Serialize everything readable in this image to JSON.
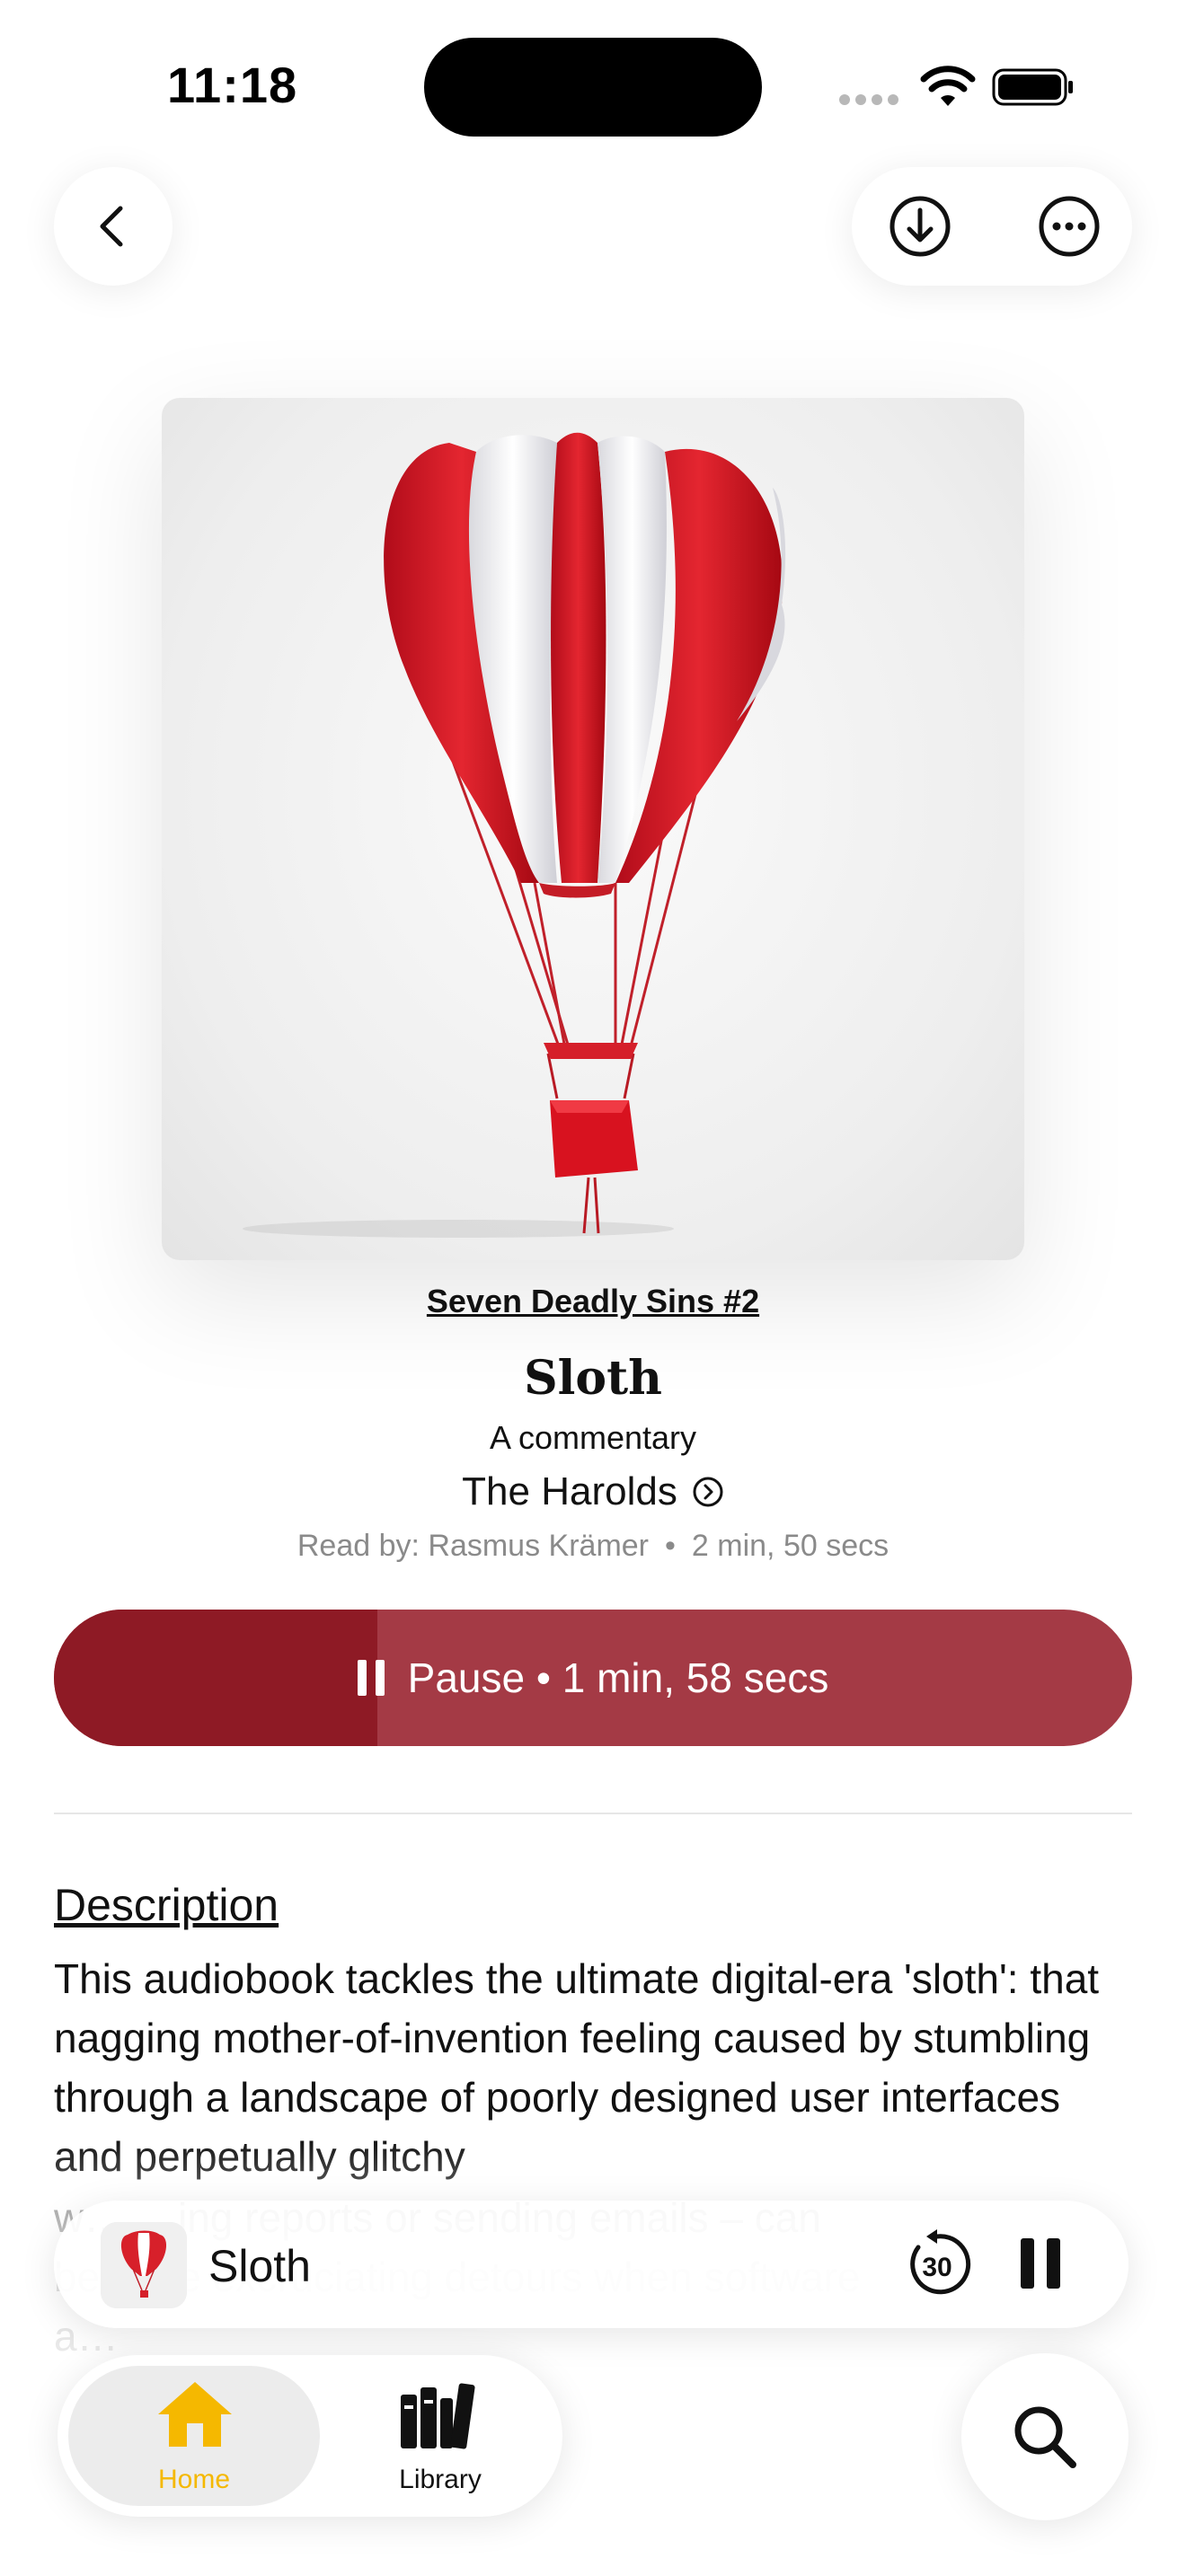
{
  "status_bar": {
    "time": "11:18"
  },
  "book": {
    "series": "Seven Deadly Sins #2",
    "title": "Sloth",
    "subtitle": "A commentary",
    "author": "The Harolds",
    "narrator": "Read by: Rasmus Krämer",
    "separator": "•",
    "duration": "2 min, 50 secs"
  },
  "player": {
    "pause_label": "Pause • 1 min, 58 secs",
    "progress_fraction": 0.3,
    "fill_color": "#8e1a25",
    "track_color": "#a43a45"
  },
  "description": {
    "heading": "Description",
    "body": "This audiobook tackles the ultimate digital-era 'sloth': that nagging mother-of-invention feeling caused by stumbling through a landscape of poorly designed user interfaces and perpetually glitchy w… …ing reports or sending emails – can become excruciating detours when software a…"
  },
  "mini_player": {
    "title": "Sloth",
    "skip_label": "30"
  },
  "tabs": [
    {
      "label": "Home",
      "active": true,
      "color": "#f5b800"
    },
    {
      "label": "Library",
      "active": false,
      "color": "#111111"
    }
  ],
  "icons": {
    "back": "chevron-left-icon",
    "download": "download-icon",
    "more": "ellipsis-icon",
    "author_link": "chevron-right-circle-icon",
    "skip": "skip-back-30-icon",
    "pause": "pause-icon",
    "home": "house-icon",
    "library": "books-icon",
    "search": "search-icon"
  }
}
